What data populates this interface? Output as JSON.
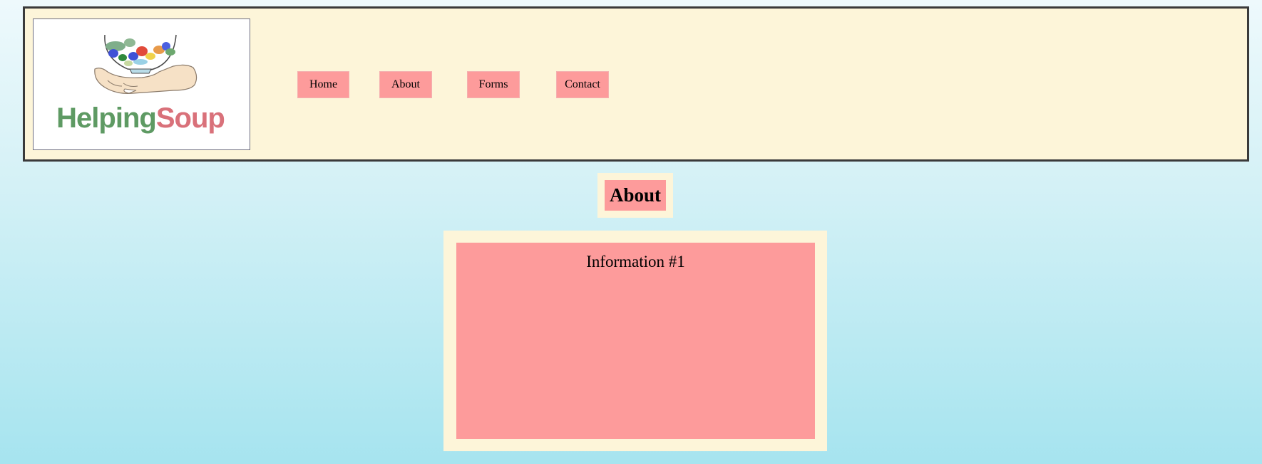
{
  "logo": {
    "icon": "salad-bowl-in-hand-icon",
    "text_part1": "Helping",
    "text_part2": "Soup",
    "color_part1": "#5e9a63",
    "color_part2": "#d9717a"
  },
  "nav": {
    "items": [
      {
        "label": "Home"
      },
      {
        "label": "About"
      },
      {
        "label": "Forms"
      },
      {
        "label": "Contact"
      }
    ]
  },
  "page": {
    "title": "About"
  },
  "info": {
    "title": "Information #1"
  },
  "colors": {
    "header_bg": "#fdf5d9",
    "accent_pink": "#fd9b9b",
    "border_dark": "#3a3a3a"
  }
}
